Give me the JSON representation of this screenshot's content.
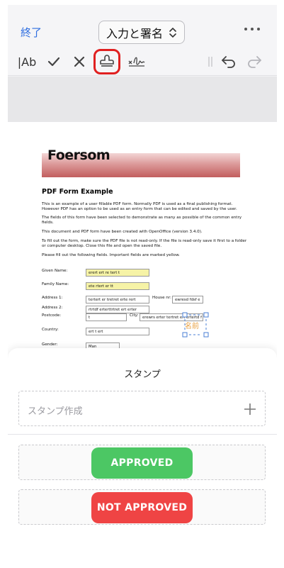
{
  "nav": {
    "done_label": "終了",
    "mode_label": "入力と署名"
  },
  "toolbar": {
    "text_tool_label": "|Ab",
    "icons": [
      "checkmark-icon",
      "cross-icon",
      "stamp-icon",
      "signature-icon",
      "undo-icon",
      "redo-icon"
    ]
  },
  "document": {
    "banner_title": "Foersom",
    "heading": "PDF Form Example",
    "paragraphs": [
      "This is an example of a user fillable PDF form. Normally PDF is used as a final publishing format. However PDF has an option to be used as an entry form that can be edited and saved by the user.",
      "The fields of this form have been selected to demonstrate as many as possible of the common entry fields.",
      "This document and PDF form have been created with OpenOffice (version 3.4.0).",
      "To fill out the form, make sure the PDF file is not read-only. If the file is read-only save it first to a folder or computer desktop. Close this file and open the saved file.",
      "Please fill out the following fields. Important fields are marked yellow."
    ],
    "fields": {
      "given_name_label": "Given Name:",
      "given_name_value": "erert ert re tert t",
      "family_name_label": "Family Name:",
      "family_name_value": "ete rtert er tt",
      "address1_label": "Address 1:",
      "address1_value": "tertert er tretret  erte rert",
      "house_nr_label": "House nr:",
      "house_nr_value": "ewresd fdsf e",
      "address2_label": "Address 2:",
      "address2_value": "rtrtdf erterttrtret ert erter",
      "postcode_label": "Postcode:",
      "postcode_value": "t",
      "city_label": "City:",
      "city_value": "erewrs erter tertret ert ertertd f",
      "country_label": "Country:",
      "country_value": "ert t ert",
      "gender_label": "Gender:",
      "gender_value": "Man"
    },
    "signature_placeholder": "名前"
  },
  "sheet": {
    "title": "スタンプ",
    "create_label": "スタンプ作成",
    "stamps": [
      {
        "label": "APPROVED",
        "color": "#4cc764"
      },
      {
        "label": "NOT APPROVED",
        "color": "#ef4444"
      }
    ]
  },
  "colors": {
    "accent": "#2f6ee0",
    "highlight_ring": "#e02020"
  }
}
